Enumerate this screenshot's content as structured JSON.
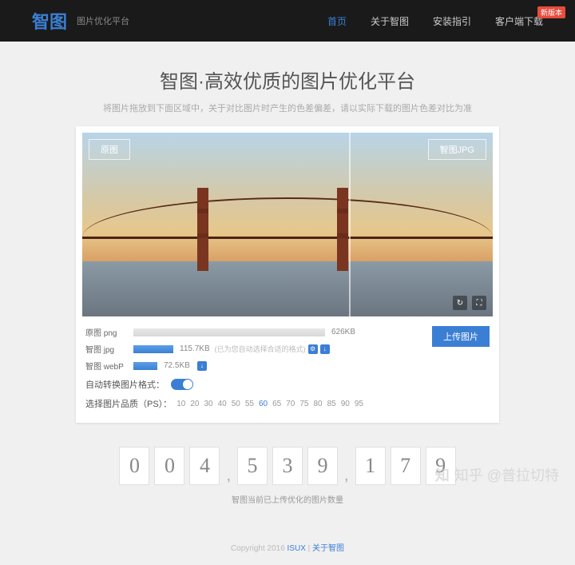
{
  "header": {
    "logo": "智图",
    "logo_sub": "图片优化平台",
    "nav": [
      {
        "label": "首页",
        "active": true
      },
      {
        "label": "关于智图"
      },
      {
        "label": "安装指引"
      },
      {
        "label": "客户端下载",
        "badge": "新版本"
      }
    ]
  },
  "hero": {
    "title": "智图·高效优质的图片优化平台",
    "subtitle": "将图片拖放到下面区域中，关于对比图片时产生的色差偏差，请以实际下载的图片色差对比为准"
  },
  "compare": {
    "left_tag": "原图",
    "right_tag": "智图JPG"
  },
  "stats": {
    "rows": [
      {
        "label": "原图 png",
        "size": "626KB"
      },
      {
        "label": "智图 jpg",
        "size": "115.7KB",
        "note": "(已为您自动选择合适的格式)"
      },
      {
        "label": "智图 webP",
        "size": "72.5KB"
      }
    ],
    "upload": "上传图片"
  },
  "auto_convert": "自动转换图片格式：",
  "quality": {
    "label": "选择图片品质（PS）：",
    "options": [
      "10",
      "20",
      "30",
      "40",
      "50",
      "55",
      "60",
      "65",
      "70",
      "75",
      "80",
      "85",
      "90",
      "95"
    ],
    "selected": "60"
  },
  "counter": {
    "digits": [
      "0",
      "0",
      "4",
      "5",
      "3",
      "9",
      "1",
      "7",
      "9"
    ],
    "caption": "智图当前已上传优化的图片数量"
  },
  "footer": {
    "copyright": "Copyright 2016 ",
    "link1": "ISUX",
    "sep": " | ",
    "link2": "关于智图"
  },
  "watermark": "知乎 @普拉切特"
}
